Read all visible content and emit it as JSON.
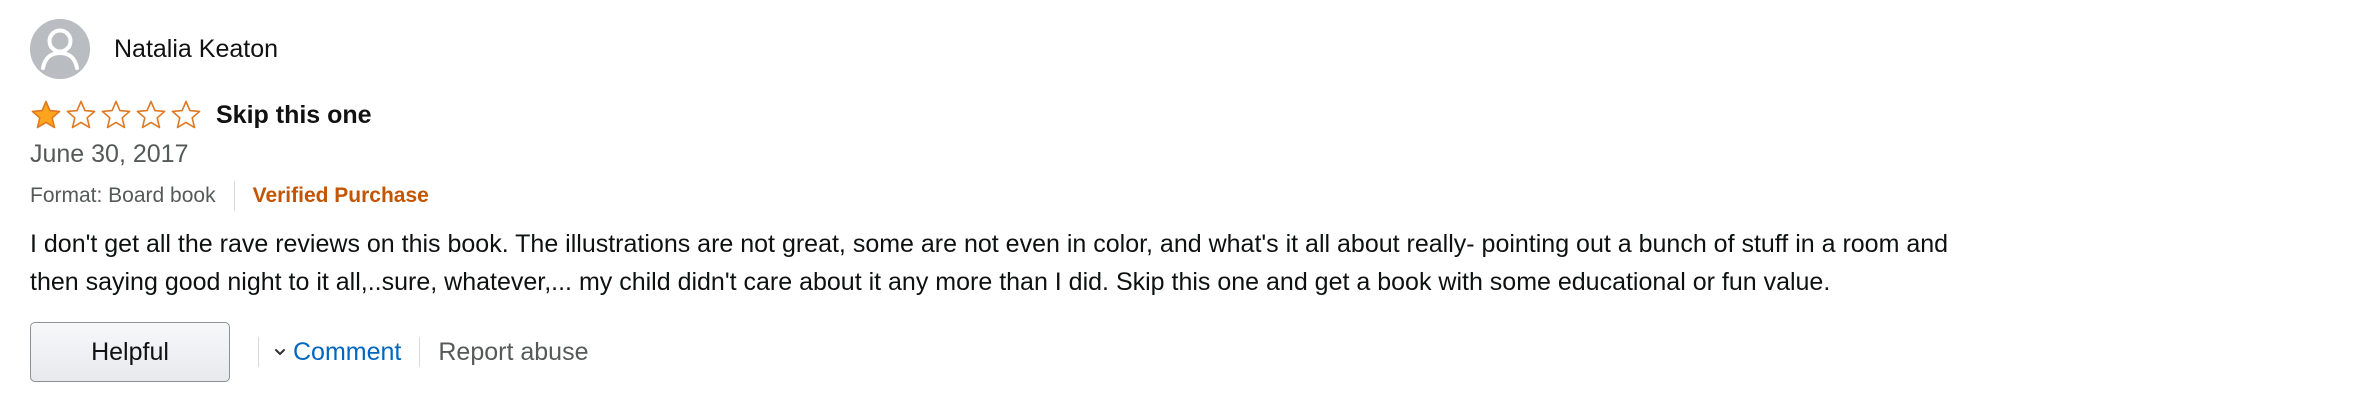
{
  "review": {
    "profile_name": "Natalia Keaton",
    "rating": {
      "value": 1,
      "max": 5,
      "filled_color": "#ffa41c",
      "empty_color": "#ffffff",
      "stroke_color": "#de7921"
    },
    "title": "Skip this one",
    "date": "June 30, 2017",
    "format": "Format: Board book",
    "verified_label": "Verified Purchase",
    "body_lines": [
      "I don't get all the rave reviews on this book. The illustrations are not great, some are not even in color, and what's it all about really- pointing out a bunch of stuff in a room and",
      "then saying good night to it all,..sure, whatever,... my child didn't care about it any more than I did. Skip this one and get a book with some educational or fun value."
    ]
  },
  "actions": {
    "helpful_label": "Helpful",
    "comment_label": "Comment",
    "report_label": "Report abuse"
  },
  "colors": {
    "link": "#0066c0",
    "verified": "#c45500",
    "muted": "#565959"
  },
  "icons": {
    "avatar": "default-user-avatar-icon",
    "star": "star-icon",
    "comment_chevron": "chevron-down-icon"
  }
}
